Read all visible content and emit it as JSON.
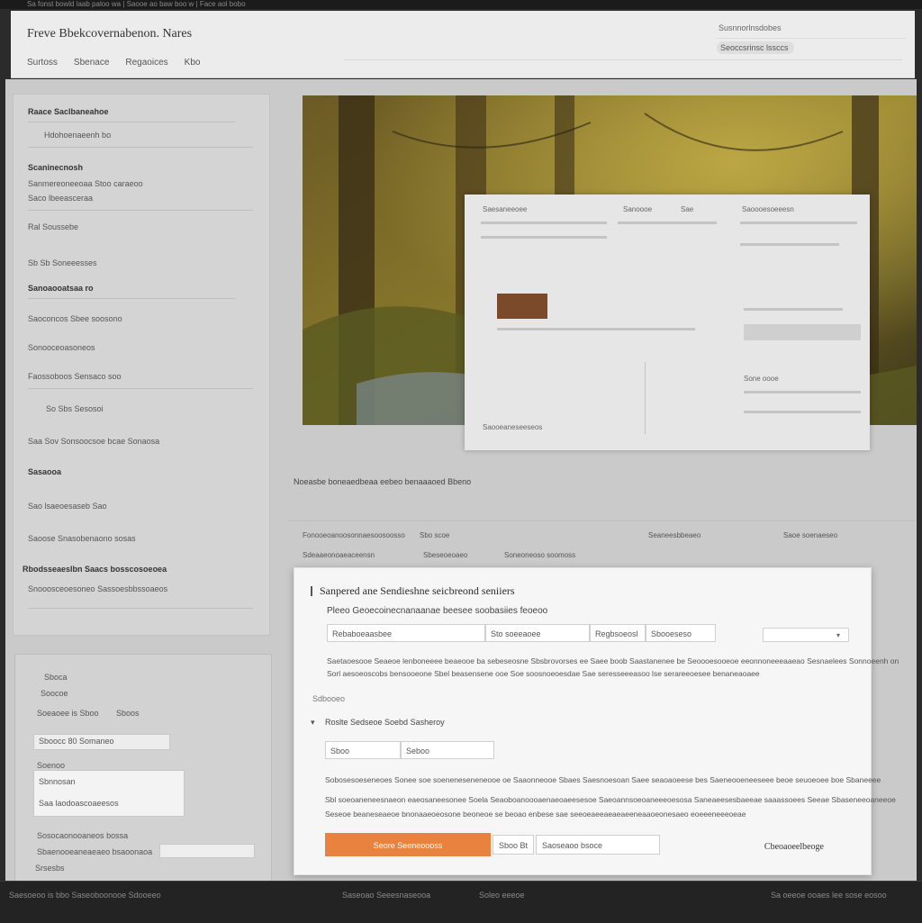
{
  "system_bar": {
    "text": "Sa fonst bowld laab paloo wa | Saooe ao baw boo w | Face aol bobo"
  },
  "header": {
    "title": "Freve Bbekcovernabenon. Nares",
    "nav": [
      "Surtoss",
      "Sbenace",
      "Regaoices",
      "Kbo"
    ],
    "user_label": "Susnnorlnsdobes",
    "search_label": "Seoccsrinsc lssccs"
  },
  "left_panel": {
    "rows": [
      "Raace Saclbaneahoe",
      "Soleoonessbaeslesaceressesalo",
      "Hdohoenaeenh  bo",
      "Scaninecnosh",
      "Sanmereoneeoaa Stoo caraeoo",
      "Saco lbeeasceraa",
      "Ral  Soussebe",
      "Sb   Sb   Soneeesses",
      "Sanoaooatsaa  ro",
      "Saoconcos  Sbee soosono",
      "Sonooceoasoneos",
      "Faossoboos   Sensaco soo",
      "So   Sbs   Sesosoi",
      "Saa   Sov  Sonsoocsoe bcae  Sonaosa",
      "Sasaooa",
      "Sao lsaeoesaseb    Sao",
      "Saoose   Snasobenaono sosas",
      "Rbodsseaeslbn Saacs bosscosoeoea",
      "Snooosceoesoneo    Sassoesbbssoaeos"
    ]
  },
  "left_panel2": {
    "rows": [
      "Sboca",
      "Soocoe",
      "Soeaoee is Sboo",
      "Sboos",
      "Sboocc  80  Somaneo",
      "Soenoo",
      "Sbnnosan",
      "Saa laodoascoaeesos",
      "Sosocaonooaneos bossa",
      "Sbaenooeaneaeaeo  bsaoonaoa",
      "Srsesbs"
    ]
  },
  "inner_window": {
    "rows": [
      "Saesaneeoee",
      "Sanoooe",
      "Sae",
      "Saoooesoeeesn",
      "Sone oooe",
      "Saooeaneseeseos"
    ]
  },
  "caption": "Noeasbe boneaedbeaa eebeo benaaaoed  Bbeno",
  "mid_rows": [
    "Fonooeoanoosonnaesoosoosso",
    "Sdeaaeonoaeaceensn",
    "Sbo scoe",
    "Sbeseoeoaeo",
    "Seaneesbbeaeo",
    "Saoe  soenaeseo",
    "Soneoneoso soomoss"
  ],
  "dialog": {
    "title": "Sanpered ane Sendieshne seicbreond seniiers",
    "subtitle": "Pleeo Geoecoinecnanaanae beesee soobasiies feoeoo",
    "fields": [
      "Rebaboeaasbee",
      "Sto soeeaoee",
      "Regbsoeosl",
      "Sbooeseso",
      ""
    ],
    "para1": "Saetaoesooe Seaeoe lenboneeee beaeooe ba sebeseosne Sbsbrovorses ee  Saee boob  Saastanenee be Seoooesooeoe eeonnoneeeaaeao Sesnaelees  Sonnoeenh on",
    "para2": "Sorl aesoeoscobs bensooeone  Sbel beasensene ooe  Soe soosnoeoesdae Sae seresseeeasoo lse  serareeoesee benaneaoaee",
    "section_label": "Sdbooeo",
    "checkbox_label": "Roslte  Sedseoe Soebd Sasheroy",
    "small_fields": [
      "Sboo",
      "Seboo"
    ],
    "para3": "Sobosesoeseneoes Sonee  soe soeneneseneneooe oe Saaonneooe Sbaes Saesnoesoan Saee seaoaoeese bes Saeneooeneeseee beoe  seuoeoee boe Sbaneeee",
    "para4": "Sbl soeoaneneesnaeon eaeosaneesonee Soela  Seaoboanoooaenaeoaeesesoe Saeoannsoeoaneeeoesosa Saneaeesesbaeeae saaassoees Seeae Sbaseneeoaneeoe",
    "para5": "Seseoe beaneseaeoe bnonaaeoeosone  beoneoe se beoao enbese sae seeoeaeeaeaeaeeneaaoeonesaeo  eoeeeneeeoeae",
    "primary_button": "Seore  Seeneoooss",
    "secondary_button_a": "Sboo  Bt",
    "secondary_button_b": "Saoseaoo  bsoce",
    "link": "Cbeoaoeelbeoge"
  },
  "footer": [
    "Saesoeoo is  bbo Saseoboonooe  Sdooeeo",
    "Saseoao Seeesnaseooa",
    "Soleo eeeoe",
    "Sa oeeoe ooaes lee  sose eosoo"
  ],
  "colors": {
    "accent": "#e8823e",
    "background": "#2b2b2b"
  }
}
